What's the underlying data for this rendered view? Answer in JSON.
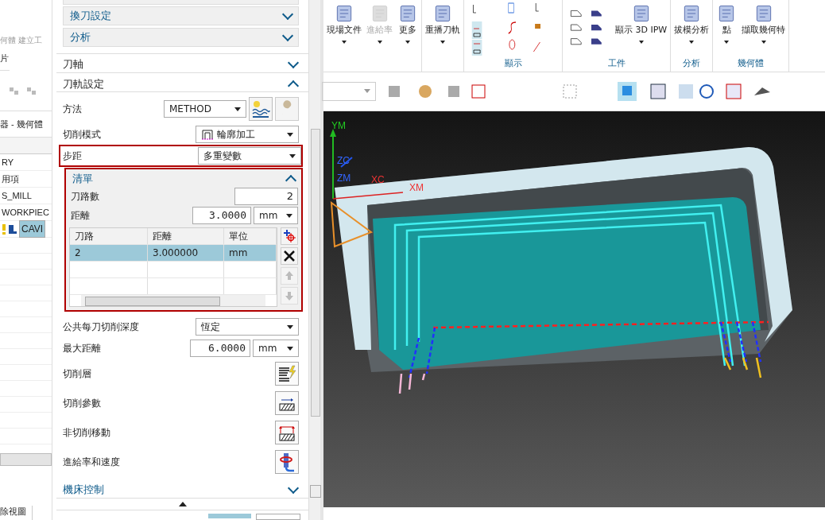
{
  "nav": {
    "ribbon_labels": [
      "何體",
      "建立工"
    ],
    "group_label": "片",
    "panel_title": "器 - 幾何體",
    "tree_items": [
      {
        "label": "RY",
        "selected": false
      },
      {
        "label": "用項",
        "selected": false
      },
      {
        "label": "S_MILL",
        "selected": false
      },
      {
        "label": "WORKPIEC",
        "selected": false
      },
      {
        "label": "CAVI",
        "selected": true,
        "warning": true
      }
    ],
    "bottom_tab": "除視圖"
  },
  "dialog": {
    "subgroups": [
      {
        "label": "換刀設定",
        "expanded": false
      },
      {
        "label": "分析",
        "expanded": false
      }
    ],
    "tool_axis": {
      "label": "刀軸",
      "expanded": false
    },
    "path_settings": {
      "label": "刀軌設定",
      "expanded": true,
      "method": {
        "label": "方法",
        "value": "METHOD"
      },
      "cut_pattern": {
        "label": "切削模式",
        "value": "輪廓加工"
      },
      "stepover": {
        "label": "步距",
        "value": "多重變數",
        "highlighted": true
      },
      "list": {
        "label": "清單",
        "expanded": true,
        "highlighted": true,
        "pass_count": {
          "label": "刀路數",
          "value": "2"
        },
        "distance": {
          "label": "距離",
          "value": "3.0000",
          "unit": "mm"
        },
        "columns": [
          "刀路",
          "距離",
          "單位"
        ],
        "rows": [
          {
            "cells": [
              "2",
              "3.000000",
              "mm"
            ],
            "selected": true
          }
        ]
      },
      "depth": {
        "label": "公共每刀切削深度",
        "value": "恆定"
      },
      "max_distance": {
        "label": "最大距離",
        "value": "6.0000",
        "unit": "mm"
      },
      "actions": [
        {
          "label": "切削層",
          "kind": "layers"
        },
        {
          "label": "切削參數",
          "kind": "params"
        },
        {
          "label": "非切削移動",
          "kind": "moves"
        },
        {
          "label": "進給率和速度",
          "kind": "feeds"
        }
      ]
    },
    "machine_control": {
      "label": "機床控制",
      "expanded": false
    }
  },
  "ribbon": {
    "groups": [
      {
        "items": [
          {
            "label": "現場文件",
            "disabled": false
          },
          {
            "label": "進給率",
            "disabled": true
          },
          {
            "label": "更多",
            "disabled": false
          }
        ]
      },
      {
        "items": [
          {
            "label": "重播刀軌",
            "disabled": false
          }
        ]
      },
      {
        "label": "顯示"
      },
      {
        "label": "工件",
        "items": [
          {
            "label": "顯示 3D IPW",
            "disabled": false
          }
        ]
      },
      {
        "label": "分析",
        "items": [
          {
            "label": "拔模分析",
            "disabled": false
          }
        ]
      },
      {
        "label": "幾何體",
        "items": [
          {
            "label": "點",
            "disabled": false
          },
          {
            "label": "擷取幾何特",
            "disabled": false
          }
        ]
      }
    ]
  },
  "viewport": {
    "axis_labels": [
      "YM",
      "XM",
      "XC",
      "ZC",
      "ZM"
    ]
  }
}
